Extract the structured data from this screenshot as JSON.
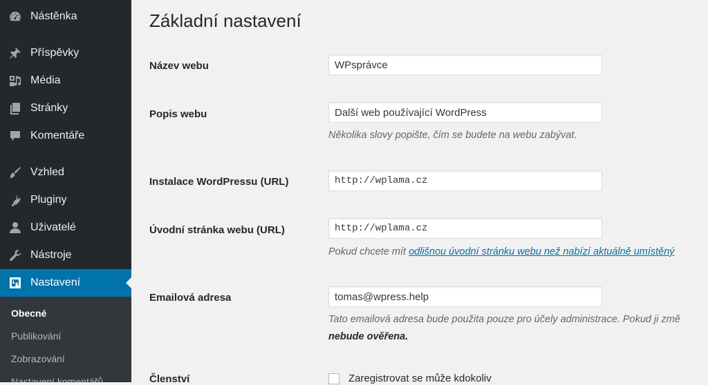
{
  "sidebar": {
    "items": [
      {
        "label": "Nástěnka",
        "icon": "dashboard-icon"
      },
      {
        "label": "Příspěvky",
        "icon": "pin-icon"
      },
      {
        "label": "Média",
        "icon": "media-icon"
      },
      {
        "label": "Stránky",
        "icon": "pages-icon"
      },
      {
        "label": "Komentáře",
        "icon": "comment-icon"
      },
      {
        "label": "Vzhled",
        "icon": "brush-icon"
      },
      {
        "label": "Pluginy",
        "icon": "plugin-icon"
      },
      {
        "label": "Uživatelé",
        "icon": "user-icon"
      },
      {
        "label": "Nástroje",
        "icon": "wrench-icon"
      },
      {
        "label": "Nastavení",
        "icon": "settings-icon",
        "current": true
      }
    ],
    "submenu": [
      {
        "label": "Obecné",
        "active": true
      },
      {
        "label": "Publikování"
      },
      {
        "label": "Zobrazování"
      },
      {
        "label": "Nastavení komentářů"
      }
    ]
  },
  "main": {
    "title": "Základní nastavení",
    "fields": {
      "site_title": {
        "label": "Název webu",
        "value": "WPsprávce"
      },
      "tagline": {
        "label": "Popis webu",
        "value": "Další web používající WordPress",
        "description": "Několika slovy popište, čím se budete na webu zabývat."
      },
      "wp_url": {
        "label": "Instalace WordPressu (URL)",
        "value": "http://wplama.cz"
      },
      "site_url": {
        "label": "Úvodní stránka webu (URL)",
        "value": "http://wplama.cz",
        "description_prefix": "Pokud chcete mít ",
        "description_link": "odlišnou úvodní stránku webu než nabízí aktuálně umístěný"
      },
      "email": {
        "label": "Emailová adresa",
        "value": "tomas@wpress.help",
        "description": "Tato emailová adresa bude použita pouze pro účely administrace. Pokud ji změ",
        "description_bold": "nebude ověřena."
      },
      "membership": {
        "label": "Členství",
        "checkbox_label": "Zaregistrovat se může kdokoliv",
        "checked": false
      }
    }
  },
  "colors": {
    "sidebar_bg": "#23282d",
    "submenu_bg": "#32373c",
    "accent": "#0073aa",
    "page_bg": "#f1f1f1"
  }
}
